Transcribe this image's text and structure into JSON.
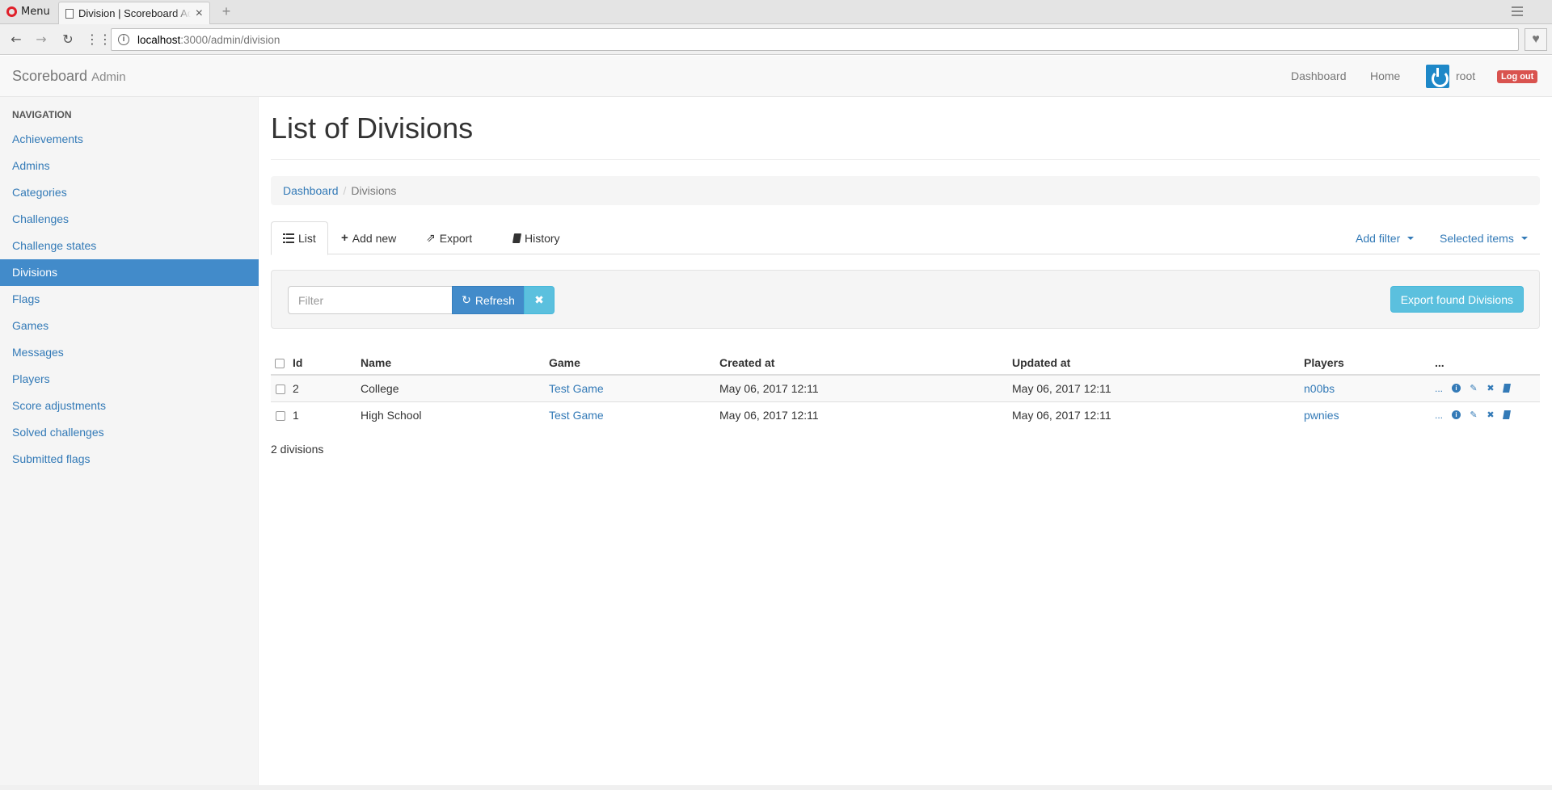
{
  "browser": {
    "menu_label": "Menu",
    "tab_title": "Division | Scoreboard Admin",
    "url_host": "localhost",
    "url_path": ":3000/admin/division"
  },
  "navbar": {
    "brand": "Scoreboard",
    "brand_sub": "Admin",
    "dashboard": "Dashboard",
    "home": "Home",
    "user": "root",
    "logout": "Log out"
  },
  "sidebar": {
    "header": "NAVIGATION",
    "items": [
      {
        "label": "Achievements"
      },
      {
        "label": "Admins"
      },
      {
        "label": "Categories"
      },
      {
        "label": "Challenges"
      },
      {
        "label": "Challenge states"
      },
      {
        "label": "Divisions"
      },
      {
        "label": "Flags"
      },
      {
        "label": "Games"
      },
      {
        "label": "Messages"
      },
      {
        "label": "Players"
      },
      {
        "label": "Score adjustments"
      },
      {
        "label": "Solved challenges"
      },
      {
        "label": "Submitted flags"
      }
    ],
    "active_index": 5
  },
  "main": {
    "title": "List of Divisions",
    "breadcrumb": [
      "Dashboard",
      "Divisions"
    ],
    "tabs": {
      "list": "List",
      "add_new": "Add new",
      "export": "Export",
      "history": "History",
      "add_filter": "Add filter",
      "selected_items": "Selected items"
    },
    "filter": {
      "placeholder": "Filter",
      "refresh": "Refresh",
      "export_found": "Export found Divisions"
    },
    "table": {
      "columns": [
        "Id",
        "Name",
        "Game",
        "Created at",
        "Updated at",
        "Players",
        "..."
      ],
      "rows": [
        {
          "id": "2",
          "name": "College",
          "game": "Test Game",
          "created": "May 06, 2017 12:11",
          "updated": "May 06, 2017 12:11",
          "players": "n00bs",
          "more": "..."
        },
        {
          "id": "1",
          "name": "High School",
          "game": "Test Game",
          "created": "May 06, 2017 12:11",
          "updated": "May 06, 2017 12:11",
          "players": "pwnies",
          "more": "..."
        }
      ]
    },
    "count": "2 divisions"
  }
}
